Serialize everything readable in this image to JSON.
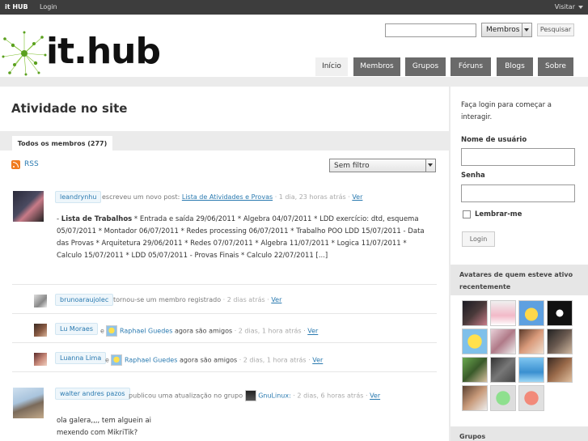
{
  "adminbar": {
    "brand": "it HUB",
    "login": "Login",
    "visit": "Visitar"
  },
  "search": {
    "placeholder": "",
    "scope": "Membros",
    "button": "Pesquisar"
  },
  "nav": {
    "tabs": [
      "Início",
      "Membros",
      "Grupos",
      "Fóruns",
      "Blogs",
      "Sobre"
    ],
    "active": 0
  },
  "logo": {
    "text": "it.hub"
  },
  "content": {
    "title": "Atividade no site",
    "filter_tab": "Todos os membros (277)",
    "rss": "RSS",
    "filter_select": "Sem filtro"
  },
  "activities": [
    {
      "user": "leandrynhu",
      "action": "escreveu um novo post:",
      "link": "Lista de Atividades e Provas",
      "time": "· 1 dia, 23 horas atrás ·",
      "view": "Ver",
      "body_title": "Lista de Trabalhos",
      "body": "* Entrada e saída 29/06/2011 * Algebra 04/07/2011 * LDD exercício: dtd, esquema 05/07/2011 * Montador 06/07/2011 * Redes processing 06/07/2011 * Trabalho POO LDD 15/07/2011 - Data das Provas * Arquitetura 29/06/2011 * Redes 07/07/2011 * Algebra 11/07/2011 * Logica 11/07/2011 * Calculo 15/07/2011 * LDD 05/07/2011 - Provas Finais * Calculo 22/07/2011 [...]"
    },
    {
      "user": "brunoaraujolec",
      "action": "tornou-se um membro registrado",
      "time": "· 2 dias atrás ·",
      "view": "Ver"
    },
    {
      "user": "Lu Moraes",
      "joiner": "e",
      "friend": "Raphael Guedes",
      "action": "agora são amigos",
      "time": "· 2 dias, 1 hora atrás ·",
      "view": "Ver"
    },
    {
      "user": "Luanna Lima",
      "joiner": "e",
      "friend": "Raphael Guedes",
      "action": "agora são amigos",
      "time": "· 2 dias, 1 hora atrás ·",
      "view": "Ver"
    },
    {
      "user": "walter andres pazos",
      "action": "publicou uma atualização no grupo",
      "group": "GnuLinux:",
      "time": "· 2 dias, 6 horas atrás ·",
      "view": "Ver",
      "body": "ola galera,,,, tem alguein ai mexendo com MikriTik?"
    }
  ],
  "sidebar": {
    "intro": "Faça login para começar a interagir.",
    "username_label": "Nome de usuário",
    "password_label": "Senha",
    "remember": "Lembrar-me",
    "login_button": "Login",
    "avatars_title": "Avatares de quem esteve ativo recentemente",
    "groups_title": "Grupos"
  },
  "colors": {
    "tab_bg": "#6a6a6a",
    "link": "#2a7ab0",
    "adminbar": "#3d3d3d",
    "rss": "#f07b1e"
  }
}
